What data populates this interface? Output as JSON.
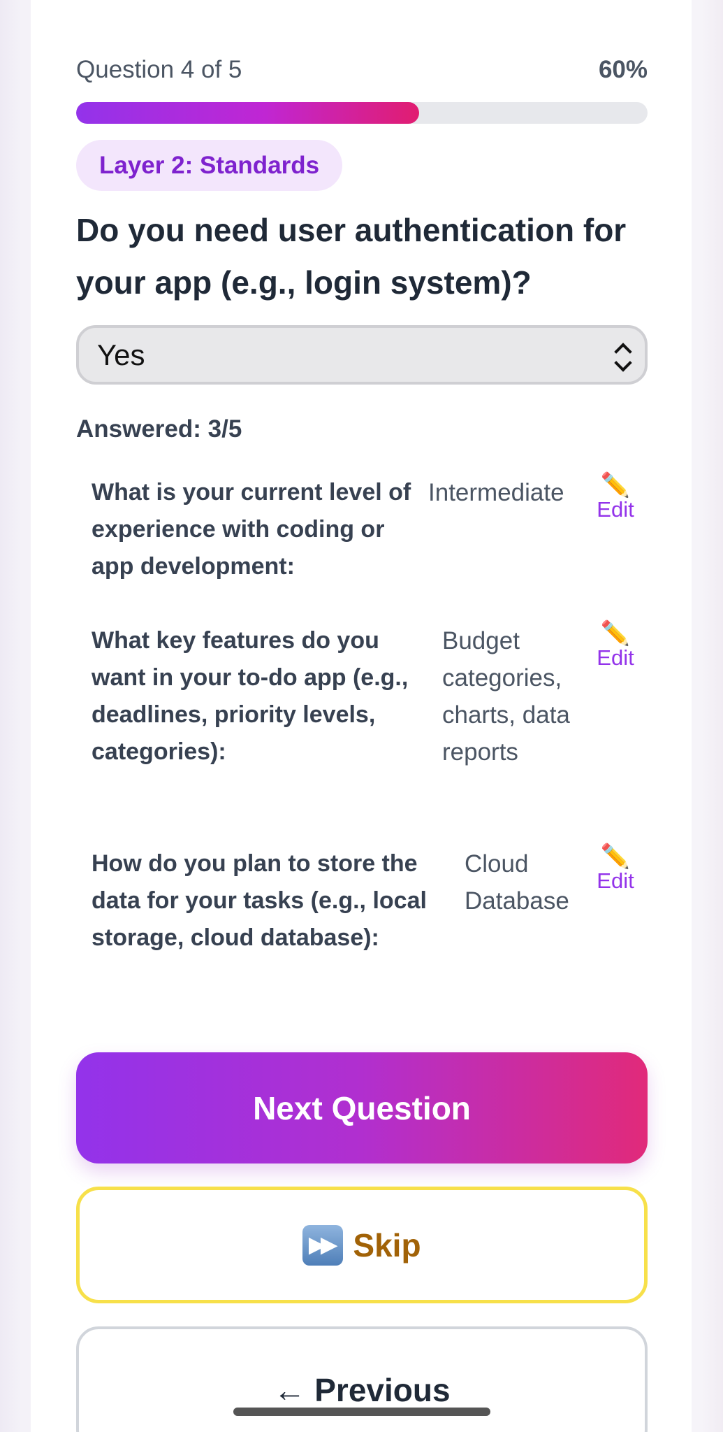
{
  "progress": {
    "label": "Question 4 of 5",
    "percent_text": "60%",
    "fill_percent": 60,
    "gradient_colors": [
      "#9333ea",
      "#c026d3",
      "#e11d70"
    ]
  },
  "layer_badge": "Layer 2: Standards",
  "question": "Do you need user authentication for your app (e.g., login system)?",
  "select": {
    "value": "Yes"
  },
  "answered_label": "Answered: 3/5",
  "answers": [
    {
      "question": "What is your current level of experience with coding or app development:",
      "value": "Intermediate",
      "edit": "Edit",
      "edit_icon": "pencil-icon"
    },
    {
      "question": "What key features do you want in your to-do app (e.g., deadlines, priority levels, categories):",
      "value": "Budget categories, charts, data reports",
      "edit": "Edit",
      "edit_icon": "pencil-icon"
    },
    {
      "question": "How do you plan to store the data for your tasks (e.g., local storage, cloud database):",
      "value": "Cloud Database",
      "edit": "Edit",
      "edit_icon": "pencil-icon"
    }
  ],
  "buttons": {
    "next": "Next Question",
    "skip": "Skip",
    "skip_icon": "next-track-icon",
    "previous": "← Previous"
  },
  "colors": {
    "accent_purple": "#9333ea",
    "accent_pink": "#e11d70",
    "skip_border": "#f7e04a",
    "skip_text": "#a16207"
  }
}
